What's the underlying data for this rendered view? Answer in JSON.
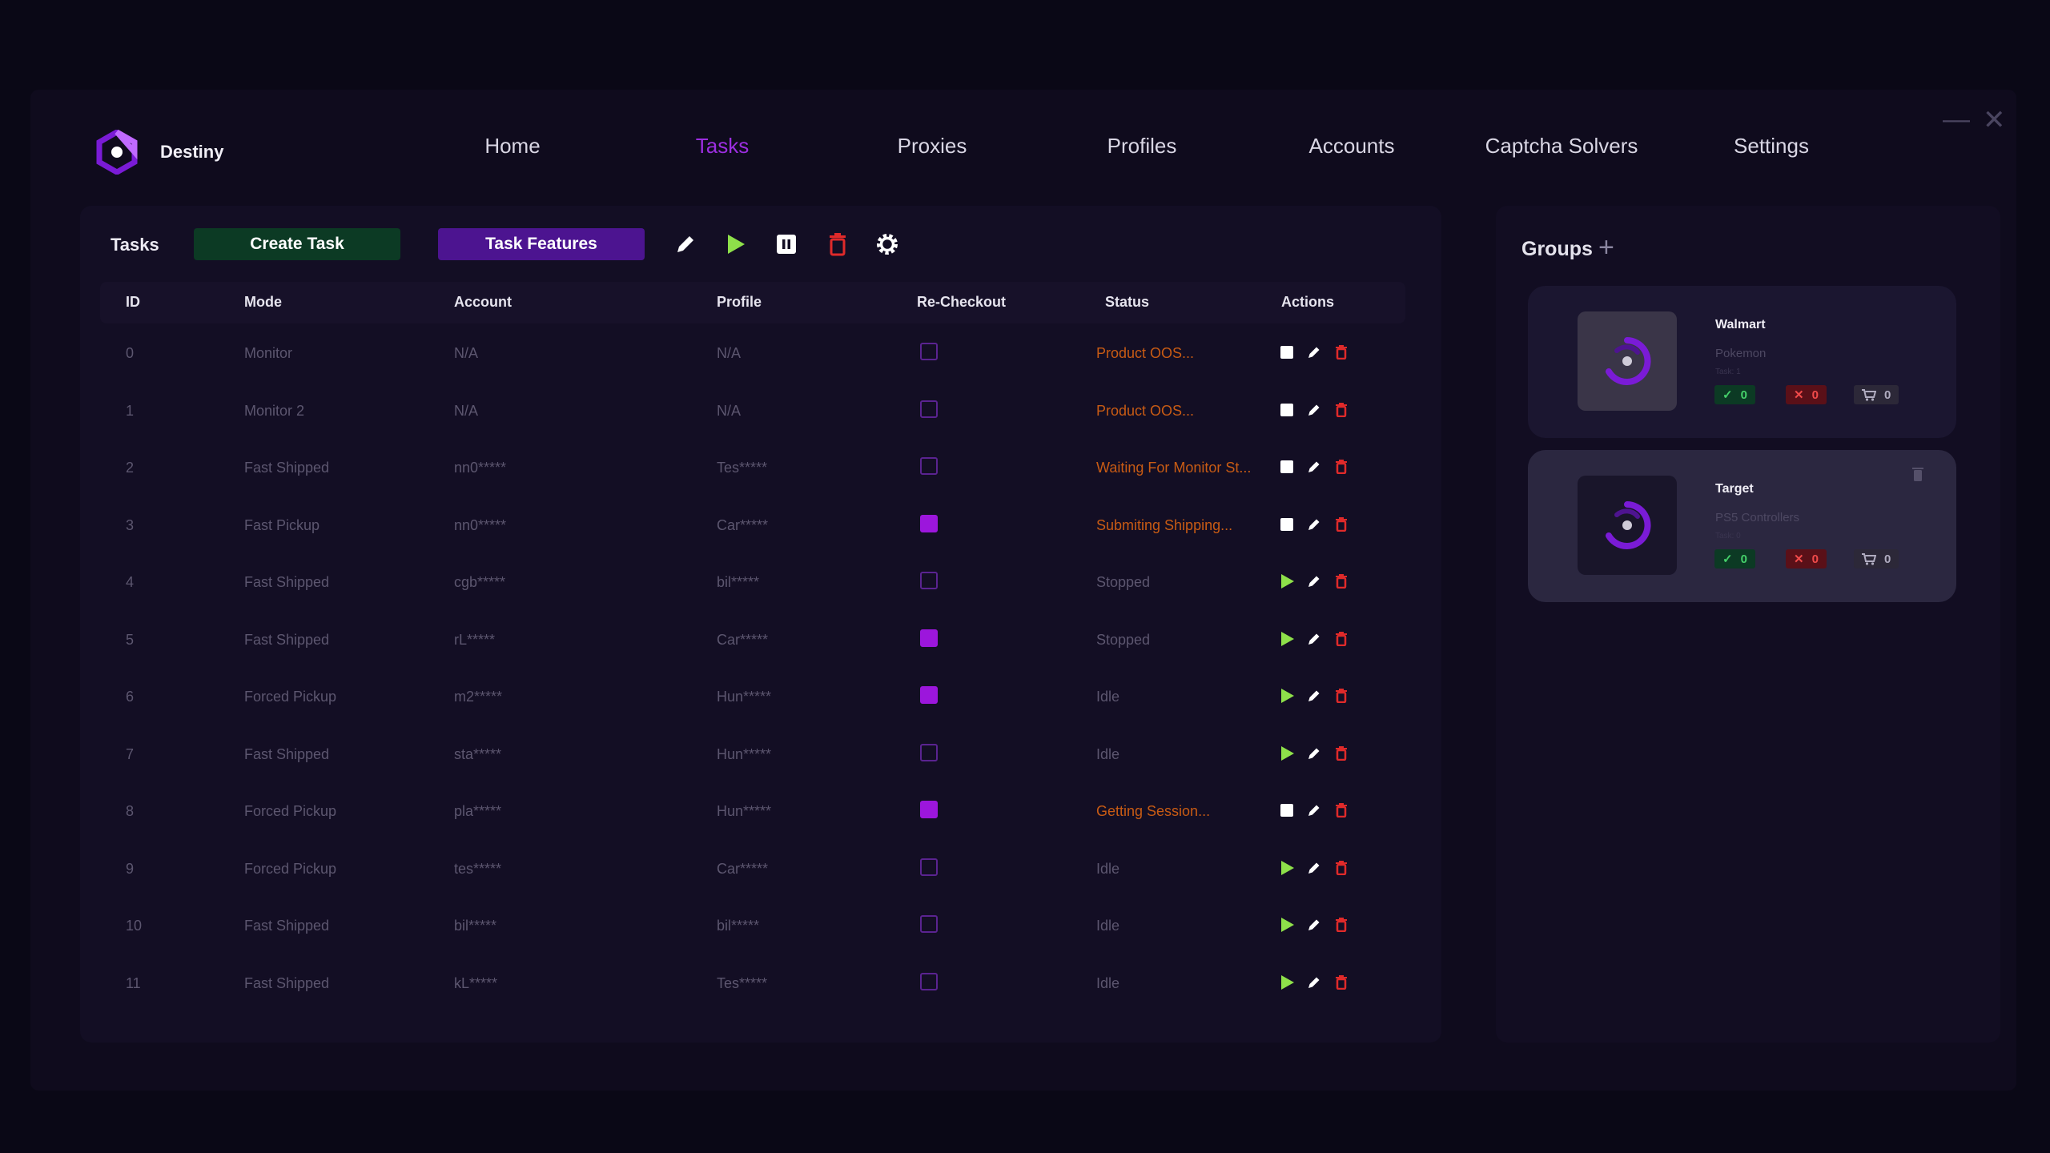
{
  "app": {
    "name": "Destiny"
  },
  "nav": [
    {
      "label": "Home",
      "active": false
    },
    {
      "label": "Tasks",
      "active": true
    },
    {
      "label": "Proxies",
      "active": false
    },
    {
      "label": "Profiles",
      "active": false
    },
    {
      "label": "Accounts",
      "active": false
    },
    {
      "label": "Captcha Solvers",
      "active": false
    },
    {
      "label": "Settings",
      "active": false
    }
  ],
  "window_controls": {
    "minimize": "—",
    "close": "✕"
  },
  "toolbar": {
    "title": "Tasks",
    "create_label": "Create Task",
    "features_label": "Task Features",
    "icons": [
      "edit-all-icon",
      "start-all-icon",
      "stop-all-icon",
      "delete-all-icon",
      "settings-icon"
    ]
  },
  "table": {
    "headers": [
      "ID",
      "Mode",
      "Account",
      "Profile",
      "Re-Checkout",
      "Status",
      "Actions"
    ],
    "rows": [
      {
        "id": "0",
        "mode": "Monitor",
        "account": "N/A",
        "profile": "N/A",
        "recheckout": false,
        "status": "Product OOS...",
        "running": true
      },
      {
        "id": "1",
        "mode": "Monitor 2",
        "account": "N/A",
        "profile": "N/A",
        "recheckout": false,
        "status": "Product OOS...",
        "running": true
      },
      {
        "id": "2",
        "mode": "Fast Shipped",
        "account": "nn0*****",
        "profile": "Tes*****",
        "recheckout": false,
        "status": "Waiting For Monitor St...",
        "running": true
      },
      {
        "id": "3",
        "mode": "Fast Pickup",
        "account": "nn0*****",
        "profile": "Car*****",
        "recheckout": true,
        "status": "Submiting Shipping...",
        "running": true
      },
      {
        "id": "4",
        "mode": "Fast Shipped",
        "account": "cgb*****",
        "profile": "bil*****",
        "recheckout": false,
        "status": "Stopped",
        "running": false
      },
      {
        "id": "5",
        "mode": "Fast Shipped",
        "account": "rL*****",
        "profile": "Car*****",
        "recheckout": true,
        "status": "Stopped",
        "running": false
      },
      {
        "id": "6",
        "mode": "Forced Pickup",
        "account": "m2*****",
        "profile": "Hun*****",
        "recheckout": true,
        "status": "Idle",
        "running": false
      },
      {
        "id": "7",
        "mode": "Fast Shipped",
        "account": "sta*****",
        "profile": "Hun*****",
        "recheckout": false,
        "status": "Idle",
        "running": false
      },
      {
        "id": "8",
        "mode": "Forced Pickup",
        "account": "pla*****",
        "profile": "Hun*****",
        "recheckout": true,
        "status": "Getting Session...",
        "running": true
      },
      {
        "id": "9",
        "mode": "Forced Pickup",
        "account": "tes*****",
        "profile": "Car*****",
        "recheckout": false,
        "status": "Idle",
        "running": false
      },
      {
        "id": "10",
        "mode": "Fast Shipped",
        "account": "bil*****",
        "profile": "bil*****",
        "recheckout": false,
        "status": "Idle",
        "running": false
      },
      {
        "id": "11",
        "mode": "Fast Shipped",
        "account": "kL*****",
        "profile": "Tes*****",
        "recheckout": false,
        "status": "Idle",
        "running": false
      }
    ]
  },
  "groups": {
    "title": "Groups",
    "add_label": "+",
    "items": [
      {
        "name": "Walmart",
        "subtitle": "Pokemon",
        "tiny": "Task: 1",
        "success": "0",
        "failed": "0",
        "carted": "0",
        "selected": false
      },
      {
        "name": "Target",
        "subtitle": "PS5 Controllers",
        "tiny": "Task: 0",
        "success": "0",
        "failed": "0",
        "carted": "0",
        "selected": true
      }
    ]
  },
  "colors": {
    "accent": "#9c2ee0",
    "status_active": "#c85b14",
    "play": "#8ee04a",
    "delete": "#e02a2a"
  }
}
